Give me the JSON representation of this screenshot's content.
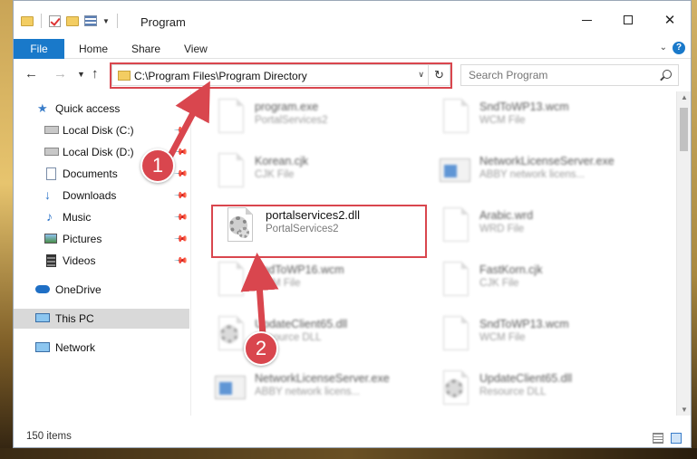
{
  "window": {
    "title": "Program"
  },
  "ribbon": {
    "tabs": [
      "File",
      "Home",
      "Share",
      "View"
    ],
    "help": "?"
  },
  "address": {
    "path": "C:\\Program Files\\Program Directory",
    "search_placeholder": "Search Program"
  },
  "nav": {
    "items": [
      {
        "label": "Quick access",
        "icon": "star-icon"
      },
      {
        "label": "Local Disk (C:)",
        "icon": "drive-icon",
        "pinned": true
      },
      {
        "label": "Local Disk (D:)",
        "icon": "drive-icon",
        "pinned": true
      },
      {
        "label": "Documents",
        "icon": "documents-icon",
        "pinned": true
      },
      {
        "label": "Downloads",
        "icon": "download-icon",
        "pinned": true
      },
      {
        "label": "Music",
        "icon": "music-icon",
        "pinned": true
      },
      {
        "label": "Pictures",
        "icon": "pictures-icon",
        "pinned": true
      },
      {
        "label": "Videos",
        "icon": "videos-icon",
        "pinned": true
      },
      {
        "label": "OneDrive",
        "icon": "cloud-icon"
      },
      {
        "label": "This PC",
        "icon": "computer-icon",
        "selected": true
      },
      {
        "label": "Network",
        "icon": "network-icon"
      }
    ]
  },
  "files": [
    {
      "name": "program.exe",
      "type": "PortalServices2",
      "icon": "exe-installer-icon",
      "blurred": true
    },
    {
      "name": "SndToWP13.wcm",
      "type": "WCM File",
      "icon": "file-icon",
      "blurred": true
    },
    {
      "name": "Korean.cjk",
      "type": "CJK File",
      "icon": "file-icon",
      "blurred": true
    },
    {
      "name": "NetworkLicenseServer.exe",
      "type": "ABBY network licens...",
      "icon": "exe-window-icon",
      "blurred": true
    },
    {
      "name": "portalservices2.dll",
      "type": "PortalServices2",
      "icon": "dll-gear-icon",
      "blurred": false
    },
    {
      "name": "Arabic.wrd",
      "type": "WRD File",
      "icon": "file-icon",
      "blurred": true
    },
    {
      "name": "SndToWP16.wcm",
      "type": "WCM File",
      "icon": "file-icon",
      "blurred": true
    },
    {
      "name": "FastKorn.cjk",
      "type": "CJK File",
      "icon": "file-icon",
      "blurred": true
    },
    {
      "name": "UpdateClient65.dll",
      "type": "Resource DLL",
      "icon": "dll-gear-icon",
      "blurred": true
    },
    {
      "name": "SndToWP13.wcm",
      "type": "WCM File",
      "icon": "file-icon",
      "blurred": true
    },
    {
      "name": "NetworkLicenseServer.exe",
      "type": "ABBY network licens...",
      "icon": "exe-window-icon",
      "blurred": true
    },
    {
      "name": "UpdateClient65.dll",
      "type": "Resource DLL",
      "icon": "dll-gear-icon",
      "blurred": true
    }
  ],
  "status": {
    "items_count": "150 items"
  },
  "annotations": {
    "step1": "1",
    "step2": "2",
    "color": "#d9464e"
  }
}
